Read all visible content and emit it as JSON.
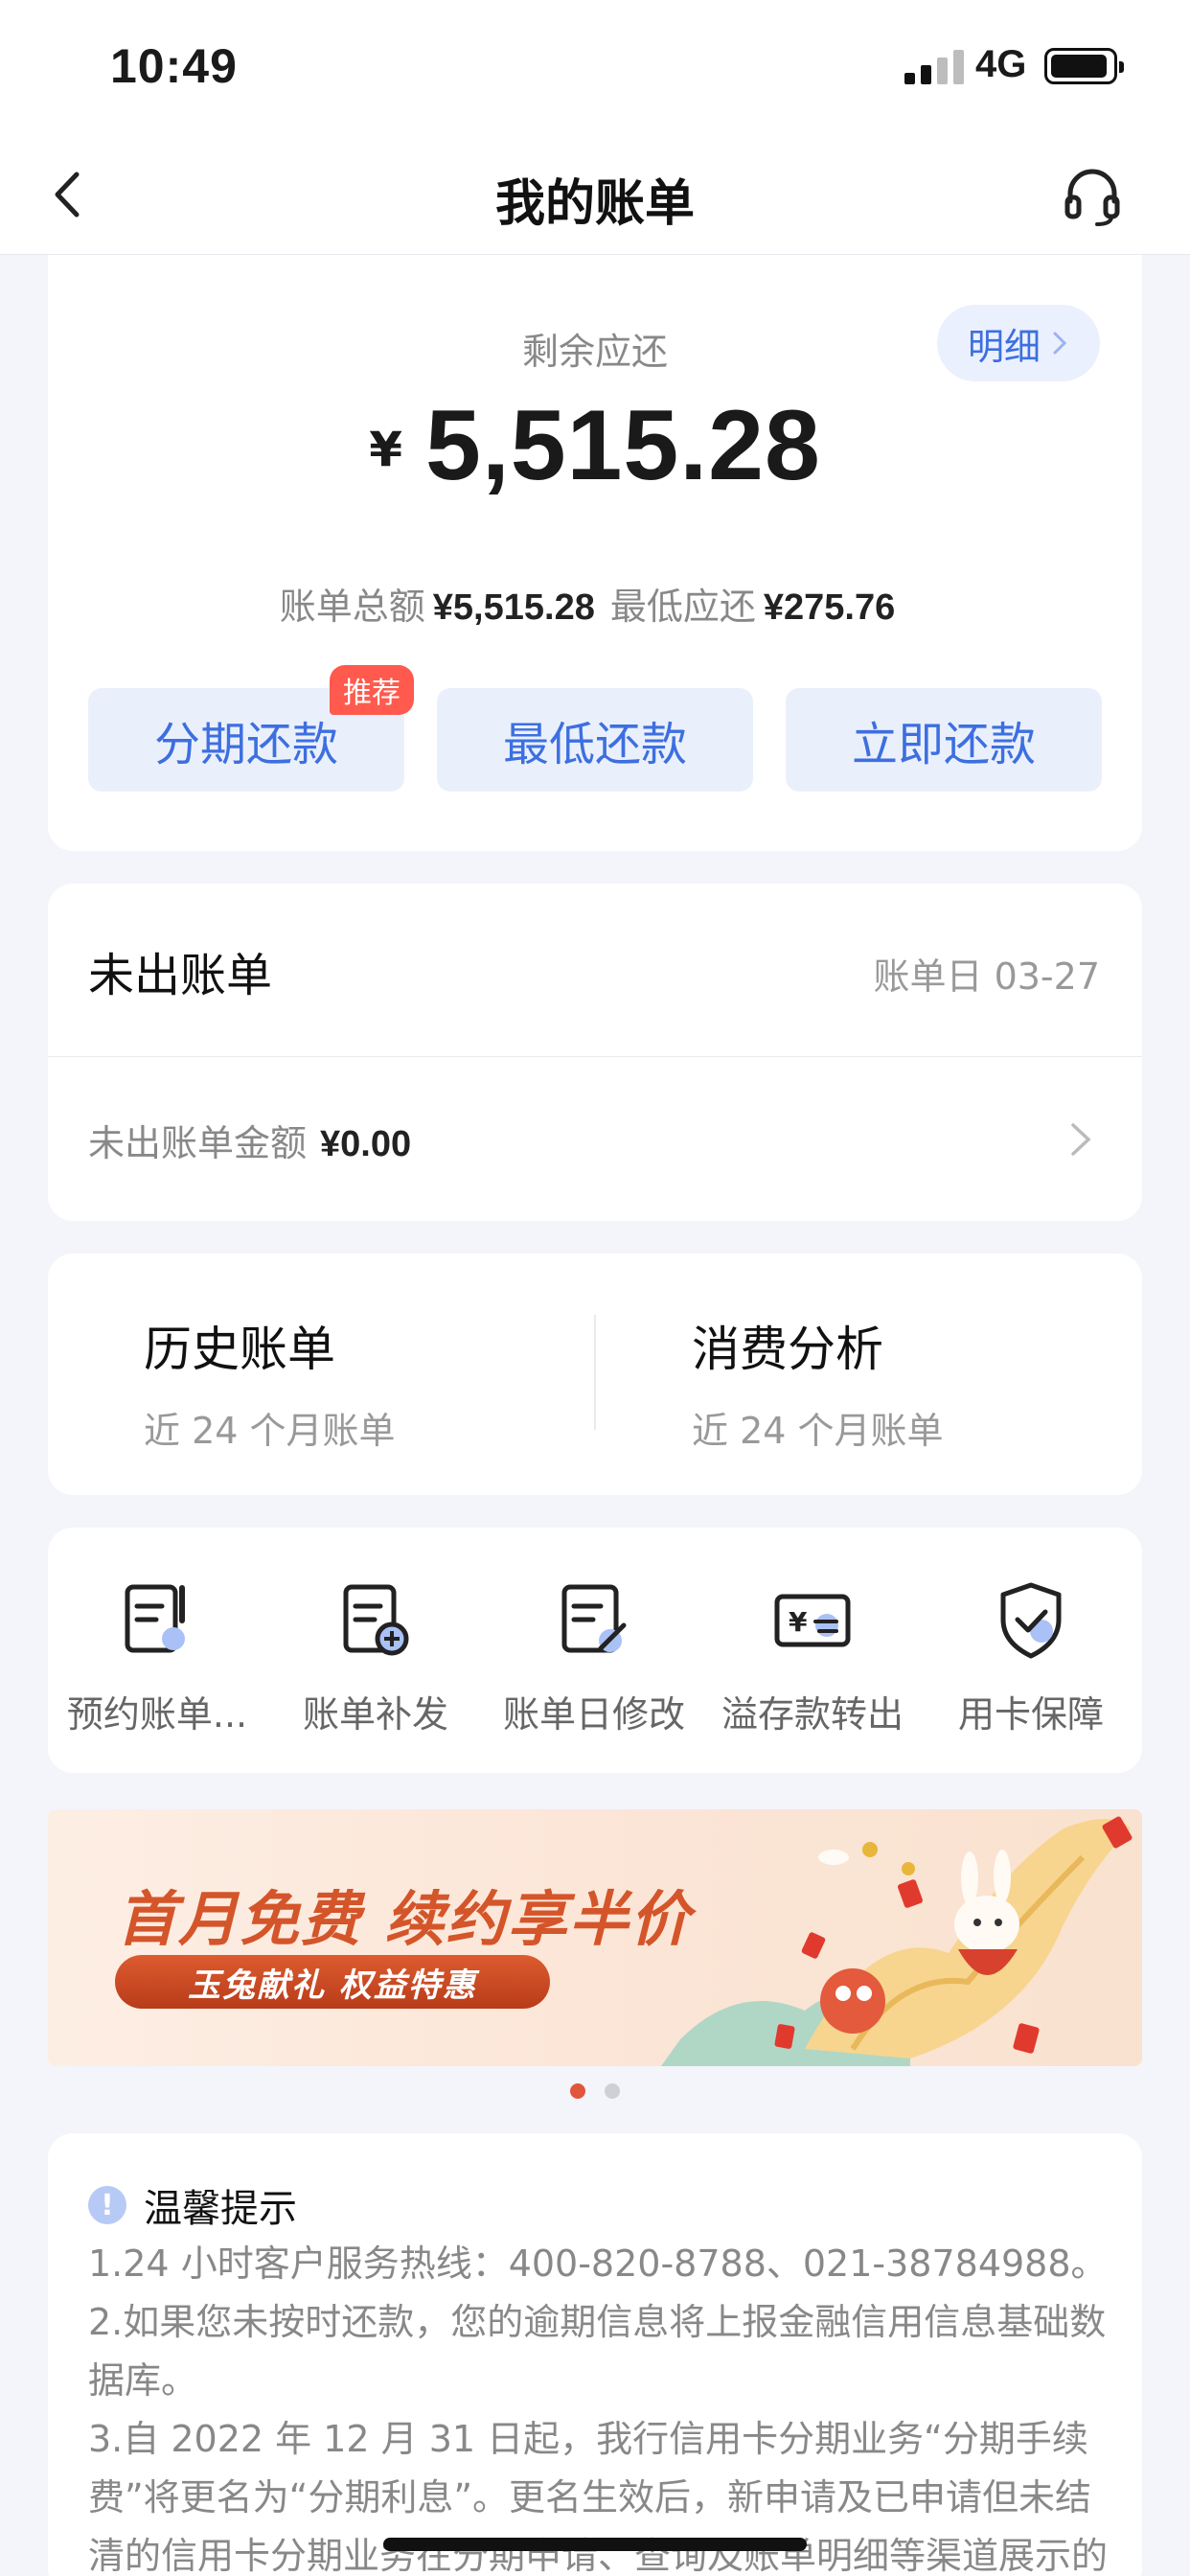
{
  "status_bar": {
    "time": "10:49",
    "network": "4G"
  },
  "nav": {
    "title": "我的账单"
  },
  "summary": {
    "label": "剩余应还",
    "detail_label": "明细",
    "currency": "¥",
    "amount": "5,515.28",
    "total_label": "账单总额",
    "total_value": "¥5,515.28",
    "min_label": "最低应还",
    "min_value": "¥275.76",
    "badge": "推荐",
    "buttons": [
      "分期还款",
      "最低还款",
      "立即还款"
    ]
  },
  "unbilled": {
    "title": "未出账单",
    "bill_date": "账单日 03-27",
    "amount_label": "未出账单金额",
    "amount_value": "¥0.00"
  },
  "history": [
    {
      "title": "历史账单",
      "subtitle": "近 24 个月账单"
    },
    {
      "title": "消费分析",
      "subtitle": "近 24 个月账单"
    }
  ],
  "tools": [
    {
      "label": "预约账单...",
      "icon": "bill-schedule-icon"
    },
    {
      "label": "账单补发",
      "icon": "bill-reissue-icon"
    },
    {
      "label": "账单日修改",
      "icon": "bill-date-edit-icon"
    },
    {
      "label": "溢存款转出",
      "icon": "overpayment-transfer-icon"
    },
    {
      "label": "用卡保障",
      "icon": "card-protection-icon"
    }
  ],
  "banner": {
    "headline": "首月免费 续约享半价",
    "tagline": "玉兔献礼 权益特惠"
  },
  "tips": {
    "title": "温馨提示",
    "lines": [
      "1.24 小时客户服务热线：400-820-8788、021-38784988。",
      "2.如果您未按时还款，您的逾期信息将上报金融信用信息基础数据库。",
      "3.自 2022 年 12 月 31 日起，我行信用卡分期业务“分期手续费”将更名为“分期利息”。更名生效后，新申请及已申请但未结清的信用卡分期业务在分期申请、查询及账单明细等渠道展示的"
    ]
  },
  "colors": {
    "accent": "#3d6fe0",
    "badge": "#ff5a4d",
    "banner_text": "#d4552a"
  }
}
